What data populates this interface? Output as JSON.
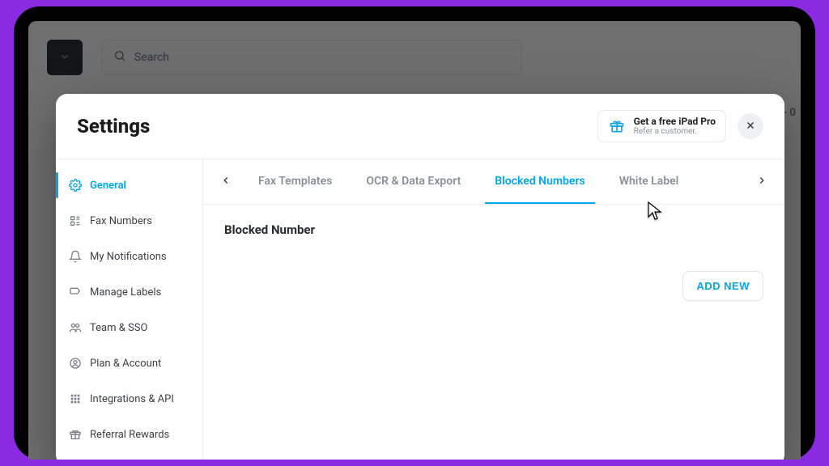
{
  "background": {
    "search_placeholder": "Search",
    "right_edge_text": "- 0"
  },
  "modal": {
    "title": "Settings",
    "promo": {
      "title": "Get a free iPad Pro",
      "subtitle": "Refer a customer."
    },
    "sidebar": {
      "items": [
        {
          "label": "General",
          "icon": "gear-icon",
          "active": true
        },
        {
          "label": "Fax Numbers",
          "icon": "phone-list-icon",
          "active": false
        },
        {
          "label": "My Notifications",
          "icon": "bell-icon",
          "active": false
        },
        {
          "label": "Manage Labels",
          "icon": "tag-icon",
          "active": false
        },
        {
          "label": "Team & SSO",
          "icon": "users-icon",
          "active": false
        },
        {
          "label": "Plan & Account",
          "icon": "user-circle-icon",
          "active": false
        },
        {
          "label": "Integrations & API",
          "icon": "grid-icon",
          "active": false
        },
        {
          "label": "Referral Rewards",
          "icon": "gift-icon",
          "active": false
        }
      ]
    },
    "tabs": [
      {
        "label": "Fax Templates",
        "active": false
      },
      {
        "label": "OCR & Data Export",
        "active": false
      },
      {
        "label": "Blocked Numbers",
        "active": true
      },
      {
        "label": "White Label",
        "active": false
      }
    ],
    "section": {
      "title": "Blocked Number",
      "add_button": "ADD NEW"
    }
  }
}
